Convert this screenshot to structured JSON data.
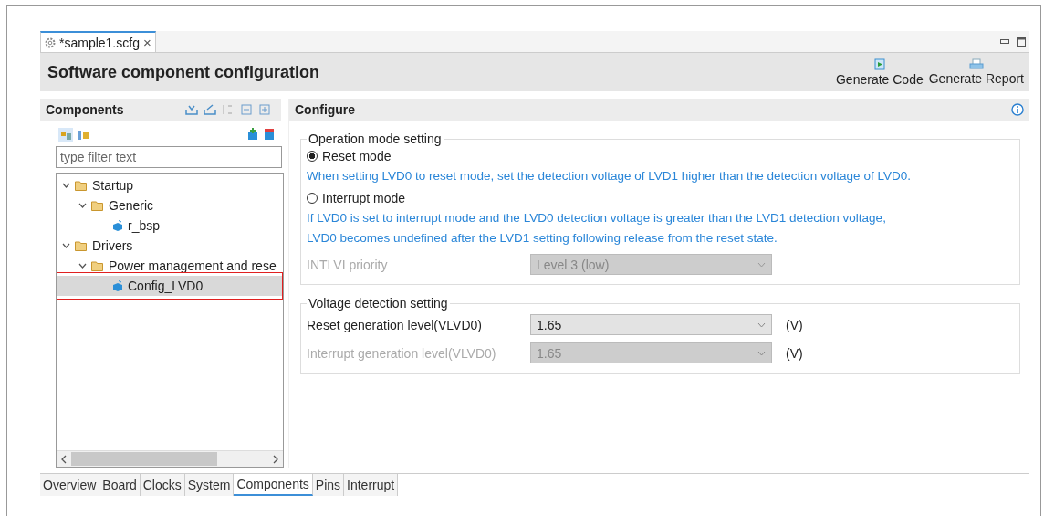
{
  "editor_tab": {
    "title": "*sample1.scfg",
    "close": "×"
  },
  "header": {
    "title": "Software component configuration",
    "actions": [
      {
        "label": "Generate Code",
        "kind": "code"
      },
      {
        "label": "Generate Report",
        "kind": "report"
      }
    ]
  },
  "components": {
    "title": "Components",
    "filter": {
      "placeholder": "type filter text"
    },
    "tree": [
      {
        "label": "Startup",
        "kind": "folder",
        "expanded": true,
        "selected": false,
        "children": [
          {
            "label": "Generic",
            "kind": "folder",
            "expanded": true,
            "selected": false,
            "children": [
              {
                "label": "r_bsp",
                "kind": "component",
                "selected": false
              }
            ]
          }
        ]
      },
      {
        "label": "Drivers",
        "kind": "folder",
        "expanded": true,
        "selected": false,
        "children": [
          {
            "label": "Power management and rese",
            "kind": "folder",
            "expanded": true,
            "selected": false,
            "children": [
              {
                "label": "Config_LVD0",
                "kind": "component",
                "selected": true
              }
            ]
          }
        ]
      }
    ]
  },
  "configure": {
    "title": "Configure",
    "operation_mode": {
      "title": "Operation mode setting",
      "options": [
        {
          "label": "Reset mode",
          "selected": true,
          "note": "When setting LVD0 to reset mode, set the detection voltage of LVD1 higher than the detection voltage of LVD0."
        },
        {
          "label": "Interrupt mode",
          "selected": false,
          "note": "If LVD0 is set to interrupt mode and the LVD0 detection voltage is greater than the LVD1 detection voltage,\nLVD0 becomes undefined after the LVD1 setting following release from the reset state."
        }
      ],
      "priority": {
        "label": "INTLVI priority",
        "value": "Level 3 (low)",
        "disabled": true
      }
    },
    "voltage": {
      "title": "Voltage detection setting",
      "rows": [
        {
          "label": "Reset generation level(VLVD0)",
          "value": "1.65",
          "unit": "(V)",
          "disabled": false
        },
        {
          "label": "Interrupt generation level(VLVD0)",
          "value": "1.65",
          "unit": "(V)",
          "disabled": true
        }
      ]
    }
  },
  "bottom_tabs": [
    {
      "label": "Overview",
      "selected": false
    },
    {
      "label": "Board",
      "selected": false
    },
    {
      "label": "Clocks",
      "selected": false
    },
    {
      "label": "System",
      "selected": false
    },
    {
      "label": "Components",
      "selected": true
    },
    {
      "label": "Pins",
      "selected": false
    },
    {
      "label": "Interrupt",
      "selected": false
    }
  ]
}
